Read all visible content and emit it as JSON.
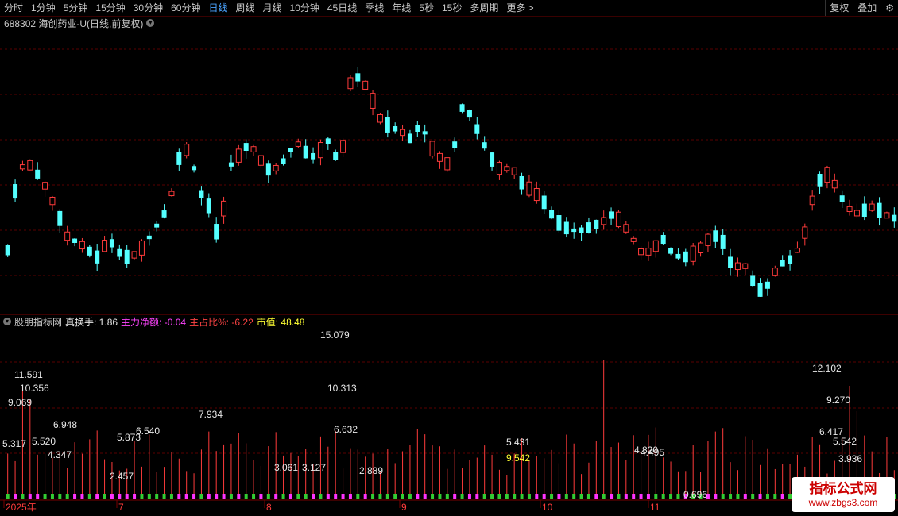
{
  "toolbar": {
    "periods": [
      "分时",
      "1分钟",
      "5分钟",
      "15分钟",
      "30分钟",
      "60分钟",
      "日线",
      "周线",
      "月线",
      "10分钟",
      "45日线",
      "季线",
      "年线",
      "5秒",
      "15秒",
      "多周期",
      "更多 >"
    ],
    "active": "日线",
    "right_buttons": [
      "复权",
      "叠加"
    ]
  },
  "title": "688302 海创药业-U(日线,前复权)",
  "indicator": {
    "name": "股朋指标网",
    "items": [
      {
        "label": "真换手: 1.86",
        "color": "#e6e6e6"
      },
      {
        "label": "主力净额: -0.04",
        "color": "#ff44ff"
      },
      {
        "label": "主占比%: -6.22",
        "color": "#ff4444"
      },
      {
        "label": "市值: 48.48",
        "color": "#ffff00"
      }
    ]
  },
  "time_axis": [
    "2025年",
    "7",
    "8",
    "9",
    "10",
    "11"
  ],
  "colors": {
    "up": "#ff3b3b",
    "down": "#54ffff",
    "grid": "#5a0000",
    "yellow": "#ffff33",
    "white": "#e8e8e8"
  },
  "chart_data": {
    "type": "candlestick+bar",
    "candles": [
      [
        31,
        17,
        44,
        10
      ],
      [
        27,
        27,
        41,
        10
      ],
      [
        12,
        16,
        18,
        10
      ],
      [
        12,
        29,
        27,
        10
      ],
      [
        28,
        29,
        31,
        10
      ],
      [
        23,
        29,
        35,
        10
      ],
      [
        33,
        33,
        38,
        10
      ],
      [
        29,
        33,
        38,
        10
      ],
      [
        35,
        27,
        42,
        10
      ],
      [
        32,
        35,
        43,
        10
      ],
      [
        35,
        24,
        26,
        10
      ],
      [
        27,
        38,
        48,
        10
      ],
      [
        23,
        23,
        49,
        10
      ],
      [
        28,
        30,
        35,
        10
      ],
      [
        30,
        34,
        38,
        10
      ],
      [
        26,
        31,
        33,
        10
      ],
      [
        25,
        29,
        30,
        10
      ],
      [
        26,
        30,
        32,
        10
      ],
      [
        28,
        29,
        31,
        10
      ],
      [
        23,
        27,
        33,
        10
      ],
      [
        27,
        32,
        35,
        10
      ],
      [
        20,
        32,
        33,
        10
      ],
      [
        21,
        27,
        31,
        10
      ],
      [
        24,
        33,
        37,
        10
      ],
      [
        20,
        29,
        31,
        10
      ],
      [
        20,
        19,
        22,
        10
      ],
      [
        17,
        24,
        28,
        10
      ],
      [
        14,
        15,
        16,
        10
      ],
      [
        15,
        14,
        17,
        10
      ],
      [
        10,
        12,
        13,
        10
      ],
      [
        13,
        10,
        14,
        10
      ],
      [
        10,
        11,
        13,
        10
      ],
      [
        12,
        14,
        15,
        10
      ],
      [
        12,
        12,
        13,
        10
      ],
      [
        13,
        12,
        14,
        10
      ],
      [
        12,
        10,
        17,
        10
      ]
    ],
    "volume_labels": [
      "15.079",
      "11.591",
      "10.356",
      "9.069",
      "12.102",
      "9.270",
      "6.417",
      "5.542",
      "10.313",
      "6.632",
      "6.948",
      "6.540",
      "7.934",
      "5.873",
      "5.431",
      "9.542",
      "4.820",
      "4.495",
      "5.317",
      "5.520",
      "4.347",
      "3.936",
      "3.127",
      "3.061",
      "2.457",
      "2.889",
      "0.696"
    ]
  }
}
